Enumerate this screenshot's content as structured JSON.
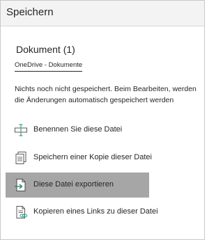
{
  "header": {
    "title": "Speichern"
  },
  "document": {
    "name": "Dokument (1)",
    "location": "OneDrive - Dokumente",
    "status": "Nichts noch nicht gespeichert. Beim Bearbeiten, werden die Änderungen automatisch gespeichert werden"
  },
  "actions": [
    {
      "label": "Benennen Sie diese Datei",
      "icon": "rename-icon",
      "selected": false
    },
    {
      "label": "Speichern einer Kopie dieser Datei",
      "icon": "save-copy-icon",
      "selected": false
    },
    {
      "label": "Diese Datei exportieren",
      "icon": "export-icon",
      "selected": true
    },
    {
      "label": "Kopieren eines Links zu dieser Datei",
      "icon": "copy-link-icon",
      "selected": false
    }
  ],
  "colors": {
    "header_bg": "#f3f3f3",
    "selected_bg": "#a6a6a6",
    "icon_accent": "#4a9a8c",
    "text": "#262626"
  }
}
